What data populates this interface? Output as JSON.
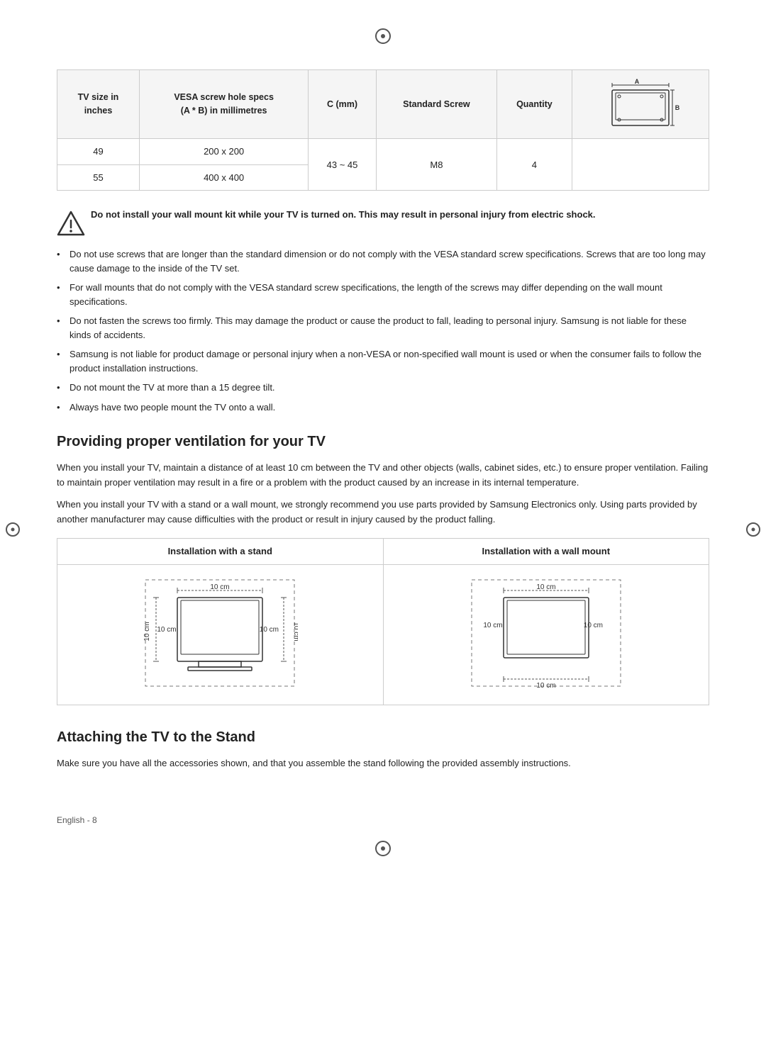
{
  "top_circle": "⊕",
  "table": {
    "headers": [
      "TV size in\ninches",
      "VESA screw hole specs\n(A * B) in millimetres",
      "C (mm)",
      "Standard Screw",
      "Quantity",
      ""
    ],
    "rows": [
      {
        "tv_size": "49",
        "vesa": "200 x 200",
        "c_mm": "43 ~ 45",
        "screw": "M8",
        "quantity": "4"
      },
      {
        "tv_size": "55",
        "vesa": "400 x 400",
        "c_mm": "43 ~ 45",
        "screw": "M8",
        "quantity": "4"
      }
    ]
  },
  "warning": {
    "bold_text": "Do not install your wall mount kit while your TV is turned on. This may result in personal injury from electric shock."
  },
  "bullets": [
    "Do not use screws that are longer than the standard dimension or do not comply with the VESA standard screw specifications. Screws that are too long may cause damage to the inside of the TV set.",
    "For wall mounts that do not comply with the VESA standard screw specifications, the length of the screws may differ depending on the wall mount specifications.",
    "Do not fasten the screws too firmly. This may damage the product or cause the product to fall, leading to personal injury. Samsung is not liable for these kinds of accidents.",
    "Samsung is not liable for product damage or personal injury when a non-VESA or non-specified wall mount is used or when the consumer fails to follow the product installation instructions.",
    "Do not mount the TV at more than a 15 degree tilt.",
    "Always have two people mount the TV onto a wall."
  ],
  "ventilation": {
    "heading": "Providing proper ventilation for your TV",
    "paragraph1": "When you install your TV, maintain a distance of at least 10 cm between the TV and other objects (walls, cabinet sides, etc.) to ensure proper ventilation. Failing to maintain proper ventilation may result in a fire or a problem with the product caused by an increase in its internal temperature.",
    "paragraph2": "When you install your TV with a stand or a wall mount, we strongly recommend you use parts provided by Samsung Electronics only. Using parts provided by another manufacturer may cause difficulties with the product or result in injury caused by the product falling.",
    "install_stand_label": "Installation with a stand",
    "install_wall_label": "Installation with a wall mount",
    "cm_top": "10 cm",
    "cm_left": "10 cm",
    "cm_right": "10 cm",
    "cm_bottom_stand": "",
    "cm_bottom_wall": "10 cm"
  },
  "attaching": {
    "heading": "Attaching the TV to the Stand",
    "paragraph": "Make sure you have all the accessories shown, and that you assemble the stand following the provided assembly instructions."
  },
  "footer": {
    "text": "English - 8"
  }
}
